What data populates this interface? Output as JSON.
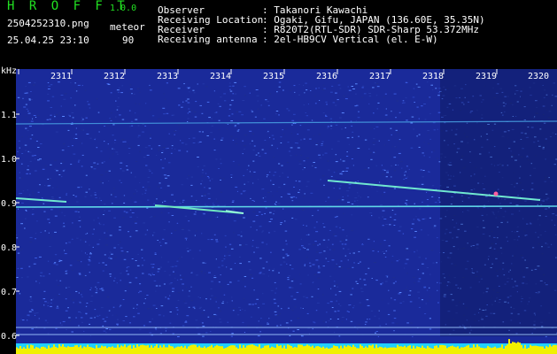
{
  "header": {
    "app_name": "H R O F F T",
    "version": "1.0.0",
    "filename": "2504252310.png",
    "mode": "meteor",
    "datetime": "25.04.25 23:10",
    "count": "90",
    "info": [
      {
        "label": "Observer",
        "value": ": Takanori Kawachi"
      },
      {
        "label": "Receiving Location",
        "value": ": Ogaki, Gifu, JAPAN (136.60E, 35.35N)"
      },
      {
        "label": "Receiver",
        "value": ": R820T2(RTL-SDR) SDR-Sharp 53.372MHz"
      },
      {
        "label": "Receiving antenna",
        "value": ": 2el-HB9CV Vertical (el. E-W)"
      }
    ]
  },
  "spectrogram": {
    "y_unit": "kHz",
    "x_ticks": [
      "2311",
      "2312",
      "2313",
      "2314",
      "2315",
      "2316",
      "2317",
      "2318",
      "2319",
      "2320"
    ],
    "y_ticks": [
      "1.1",
      "1.0",
      "0.9",
      "0.8",
      "0.7",
      "0.6"
    ],
    "colors": {
      "background": "#1a2a9a",
      "noise": "#3050d0",
      "trace": "#60e0e0",
      "bar": "#f0f000",
      "bar_bg": "#20d0ff"
    }
  }
}
